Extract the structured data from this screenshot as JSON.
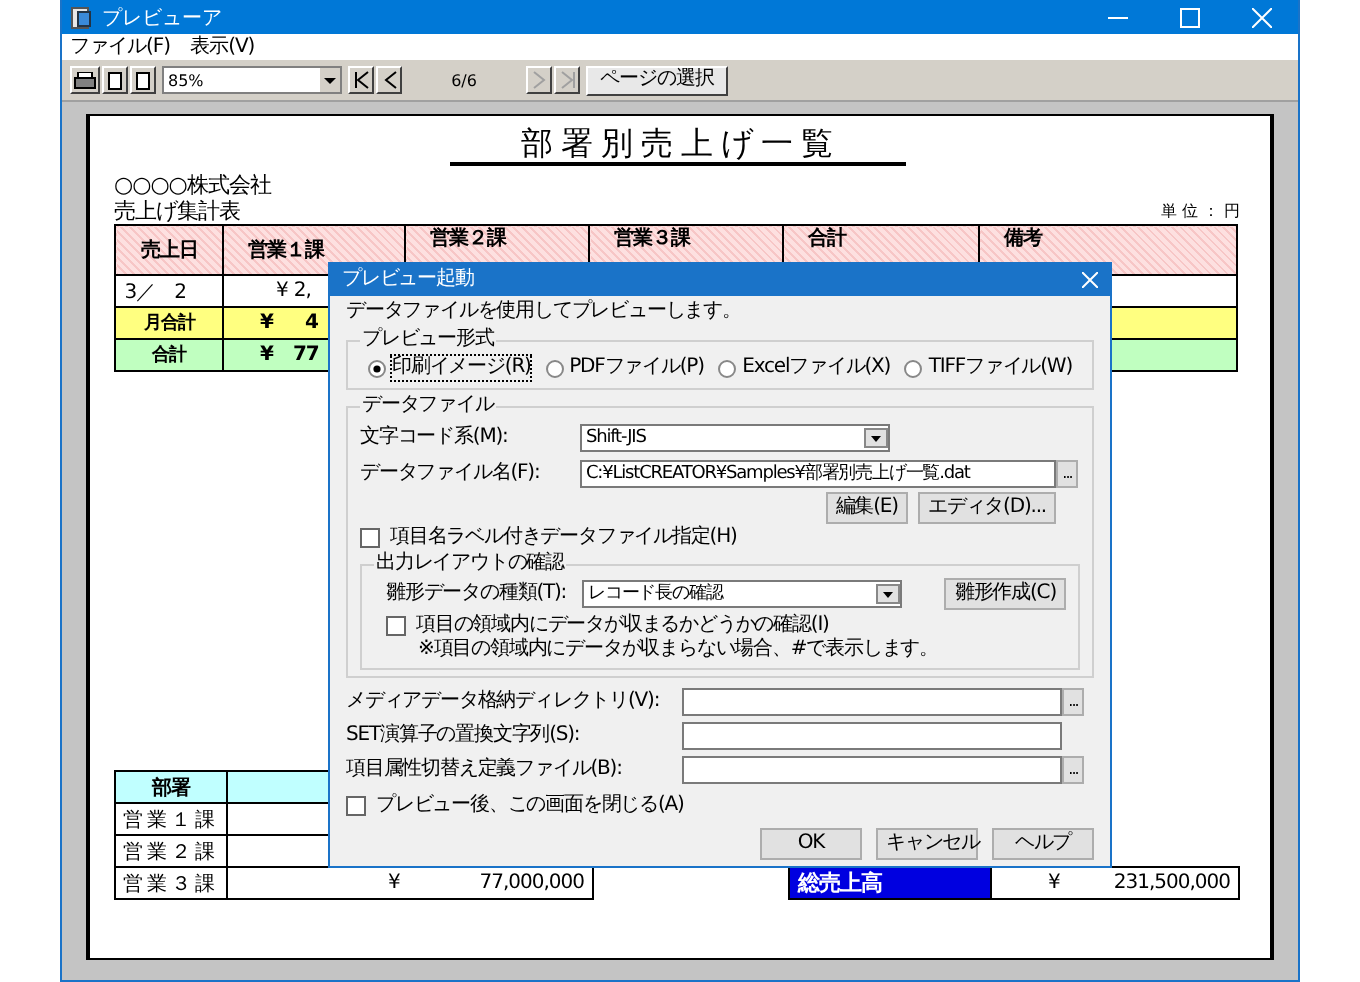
{
  "window": {
    "title": "プレビューア",
    "menu": [
      {
        "label": "ファイル(F)"
      },
      {
        "label": "表示(V)"
      }
    ]
  },
  "toolbar": {
    "zoom": "85%",
    "page": "6/6",
    "nav": [
      {
        "kind": "first",
        "disabled": false
      },
      {
        "kind": "prev",
        "disabled": false
      },
      {
        "kind": "next",
        "disabled": true
      },
      {
        "kind": "last",
        "disabled": true
      }
    ],
    "select_page": "ページの選択"
  },
  "report": {
    "title": "部署別売上げ一覧",
    "company": "○○○○株式会社",
    "subtitle": "売上げ集計表",
    "unit": "単 位 ： 円",
    "columns": [
      "売上日",
      "営業１課",
      "営業２課",
      "営業３課",
      "合計",
      "備考"
    ],
    "rows": [
      {
        "kind": "data",
        "label": "3／　2",
        "yen": "¥",
        "amount": "2,"
      },
      {
        "kind": "month_total",
        "label": "月合計",
        "yen": "¥",
        "amount": "4"
      },
      {
        "kind": "total",
        "label": "合計",
        "yen": "¥",
        "amount": "77"
      }
    ],
    "summary": {
      "header": "部署",
      "rows": [
        {
          "label": "営業１課"
        },
        {
          "label": "営業２課"
        },
        {
          "label": "営業３課",
          "yen": "¥",
          "amount": "77,000,000"
        }
      ],
      "total": {
        "label": "総売上高",
        "yen": "¥",
        "amount": "231,500,000"
      }
    }
  },
  "dialog": {
    "title": "プレビュー起動",
    "intro": "データファイルを使用してプレビューします。",
    "preview_format": {
      "legend": "プレビュー形式",
      "options": [
        {
          "label": "印刷イメージ(R)",
          "selected": true
        },
        {
          "label": "PDFファイル(P)",
          "selected": false
        },
        {
          "label": "Excelファイル(X)",
          "selected": false
        },
        {
          "label": "TIFFファイル(W)",
          "selected": false
        }
      ]
    },
    "data_file": {
      "legend": "データファイル",
      "encoding_label": "文字コード系(M):",
      "encoding": "Shift-JIS",
      "file_label": "データファイル名(F):",
      "file": "C:¥ListCREATOR¥Samples¥部署別売上げ一覧.dat",
      "file_browse": "...",
      "buttons": [
        "編集(E)",
        "エディタ(D)..."
      ],
      "label_file": {
        "label": "項目名ラベル付きデータファイル指定(H)",
        "checked": false
      },
      "layout_check": {
        "legend": "出力レイアウトの確認",
        "template_label": "雛形データの種類(T):",
        "template": "レコード長の確認",
        "create_button": "雛形作成(C)",
        "fit_check": {
          "label": "項目の領域内にデータが収まるかどうかの確認(I)",
          "checked": false
        },
        "note": "※項目の領域内にデータが収まらない場合、#で表示します。"
      }
    },
    "fields": [
      {
        "label": "メディアデータ格納ディレクトリ(V):",
        "browse": "..."
      },
      {
        "label": "SET演算子の置換文字列(S):"
      },
      {
        "label": "項目属性切替え定義ファイル(B):",
        "browse": "..."
      }
    ],
    "close_after": {
      "label": "プレビュー後、この画面を閉じる(A)",
      "checked": false
    },
    "buttons": [
      "OK",
      "キャンセル",
      "ヘルプ"
    ]
  }
}
